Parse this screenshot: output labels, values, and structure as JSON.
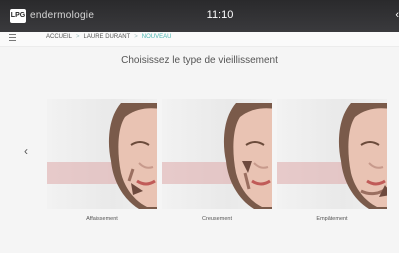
{
  "topbar": {
    "logo_text": "LPG",
    "brand": "endermologie",
    "time": "11:10",
    "back_icon": "back-arrow-icon"
  },
  "breadcrumb": {
    "items": [
      "ACCUEIL",
      "LAURE DURANT",
      "NOUVEAU"
    ],
    "separator": ">"
  },
  "main": {
    "title": "Choisissez le type de vieillissement",
    "prev_icon": "chevron-left-icon",
    "options": [
      {
        "label": "Affaissement"
      },
      {
        "label": "Creusement"
      },
      {
        "label": "Empâtement"
      }
    ]
  },
  "colors": {
    "accent": "#4bb7b3",
    "topbar": "#2f2f31",
    "band": "#e3aaaa"
  }
}
